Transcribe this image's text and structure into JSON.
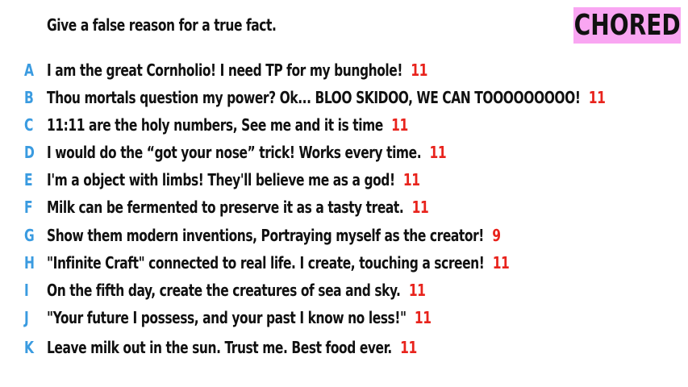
{
  "prompt": "Give a false reason for a true fact.",
  "stamp": "CHORED",
  "colors": {
    "letter": "#3a9be0",
    "score": "#e8231c",
    "stamp_bg": "#f9a6f2",
    "text": "#111111"
  },
  "answers": [
    {
      "letter": "A",
      "text": "I am the great Cornholio! I need TP for my bunghole!",
      "score": "11"
    },
    {
      "letter": "B",
      "text": "Thou mortals question my power? Ok... BLOO SKIDOO, WE CAN TOOOOOOOOO!",
      "score": "11"
    },
    {
      "letter": "C",
      "text": "11:11 are the holy numbers, See me and it is time",
      "score": "11"
    },
    {
      "letter": "D",
      "text": "I would do the “got your nose” trick! Works every time.",
      "score": "11"
    },
    {
      "letter": "E",
      "text": "I'm a object with limbs! They'll believe me as a god!",
      "score": "11"
    },
    {
      "letter": "F",
      "text": "Milk can be fermented to preserve it as a tasty treat.",
      "score": "11"
    },
    {
      "letter": "G",
      "text": "Show them modern inventions, Portraying myself as the creator!",
      "score": "9"
    },
    {
      "letter": "H",
      "text": "\"Infinite Craft\" connected to real life. I create, touching a screen!",
      "score": "11"
    },
    {
      "letter": "I",
      "text": "On the fifth day, create the creatures of sea and sky.",
      "score": "11"
    },
    {
      "letter": "J",
      "text": "\"Your future I possess, and your past I know no less!\"",
      "score": "11"
    },
    {
      "letter": "K",
      "text": "Leave milk out in the sun. Trust me. Best food ever.",
      "score": "11"
    }
  ]
}
